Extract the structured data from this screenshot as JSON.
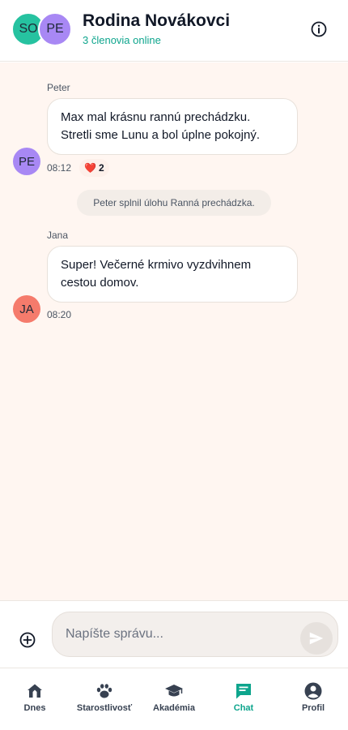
{
  "header": {
    "avatars": [
      "SO",
      "PE"
    ],
    "title": "Rodina Novákovci",
    "subtitle": "3 členovia online",
    "info_icon": "info-icon"
  },
  "messages": [
    {
      "sender": "Peter",
      "avatar": "PE",
      "lines": [
        "Max mal krásnu rannú prechádzku.",
        "Stretli sme Lunu a bol úplne pokojný."
      ],
      "time": "08:12",
      "reaction": {
        "emoji": "❤️",
        "count": "2"
      }
    },
    {
      "sender": "Jana",
      "avatar": "JA",
      "lines": [
        "Super! Večerné krmivo vyzdvihnem",
        "cestou domov."
      ],
      "time": "08:20"
    }
  ],
  "system_message": "Peter splnil úlohu Ranná prechádzka.",
  "composer": {
    "placeholder": "Napíšte správu...",
    "add_icon": "plus-circle-icon",
    "send_icon": "send-icon"
  },
  "nav": {
    "items": [
      {
        "label": "Dnes",
        "icon": "home-icon"
      },
      {
        "label": "Starostlivosť",
        "icon": "paw-icon"
      },
      {
        "label": "Akadémia",
        "icon": "graduation-cap-icon"
      },
      {
        "label": "Chat",
        "icon": "chat-icon",
        "active": true
      },
      {
        "label": "Profil",
        "icon": "profile-icon"
      }
    ]
  },
  "colors": {
    "accent": "#0ea58d",
    "chat_background": "#fff6f1",
    "avatar_so": "#26c2a0",
    "avatar_pe": "#a888f4",
    "avatar_ja": "#f57b6c"
  }
}
